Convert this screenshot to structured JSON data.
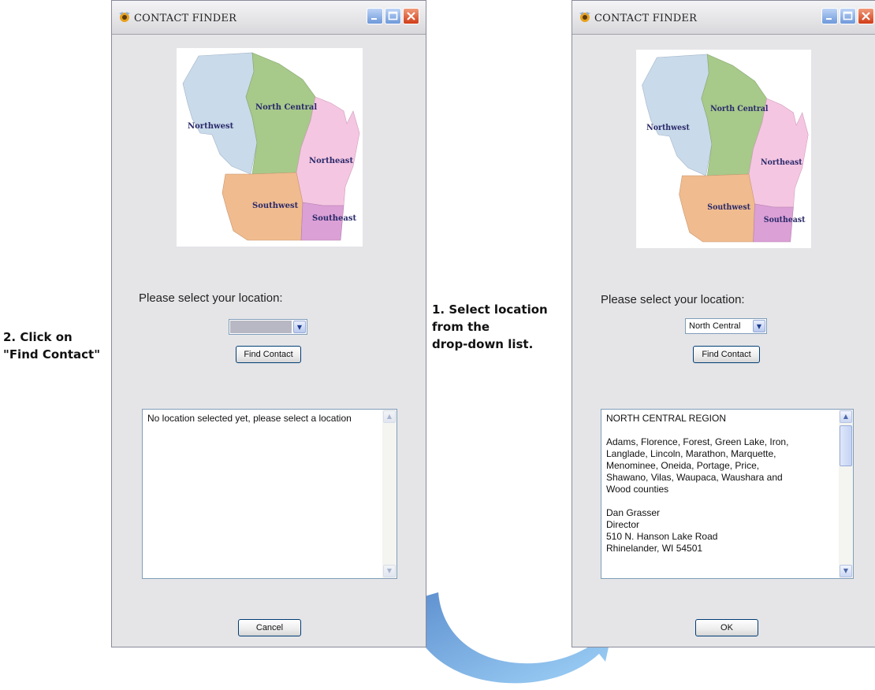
{
  "windows": {
    "left": {
      "title": "CONTACT FINDER",
      "map_regions": [
        "Northwest",
        "North Central",
        "Northeast",
        "Southwest",
        "Southeast"
      ],
      "prompt": "Please select your location:",
      "select_value": "",
      "find_button": "Find Contact",
      "text_lines": [
        "No location selected yet, please select a location"
      ],
      "footer_button": "Cancel"
    },
    "right": {
      "title": "CONTACT FINDER",
      "map_regions": [
        "Northwest",
        "North Central",
        "Northeast",
        "Southwest",
        "Southeast"
      ],
      "prompt": "Please select your location:",
      "select_value": "North Central",
      "find_button": "Find Contact",
      "text_lines": [
        "NORTH CENTRAL REGION",
        "",
        "Adams, Florence, Forest, Green Lake, Iron,",
        "Langlade, Lincoln, Marathon, Marquette,",
        "Menominee, Oneida, Portage, Price,",
        "Shawano, Vilas, Waupaca, Waushara and",
        "Wood counties",
        "",
        "Dan Grasser",
        "Director",
        "510 N. Hanson Lake Road",
        "Rhinelander, WI 54501"
      ],
      "footer_button": "OK"
    }
  },
  "annotations": {
    "step1": [
      "1. Select location",
      "from the",
      "drop-down list."
    ],
    "step2": [
      "2. Click on",
      "\"Find Contact\""
    ]
  },
  "colors": {
    "northwest": "#c9daea",
    "north_central": "#a7c98a",
    "northeast": "#f5c6e2",
    "southwest": "#f0bb8e",
    "southeast": "#dba0d6",
    "arrow": "#8ec7f2",
    "curved_arrow": "#6a9fd8"
  }
}
